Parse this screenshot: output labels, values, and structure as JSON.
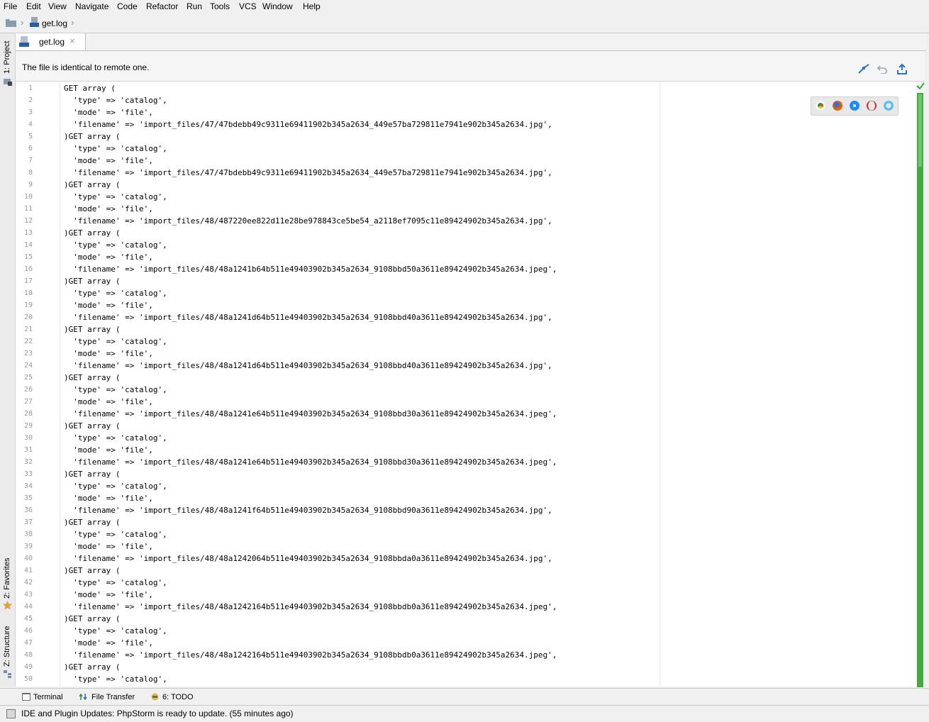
{
  "menu": [
    "File",
    "Edit",
    "View",
    "Navigate",
    "Code",
    "Refactor",
    "Run",
    "Tools",
    "VCS",
    "Window",
    "Help"
  ],
  "breadcrumb": {
    "file": "get.log"
  },
  "left_tools": {
    "project": "1: Project",
    "favorites": "2: Favorites",
    "structure": "Z: Structure"
  },
  "tab": {
    "label": "get.log",
    "close": "×",
    "icon_text": "LOG"
  },
  "notice": {
    "text": "The file is identical to remote one."
  },
  "editor": {
    "lines": [
      "GET array (",
      "  'type' => 'catalog',",
      "  'mode' => 'file',",
      "  'filename' => 'import_files/47/47bdebb49c9311e69411902b345a2634_449e57ba729811e7941e902b345a2634.jpg',",
      ")GET array (",
      "  'type' => 'catalog',",
      "  'mode' => 'file',",
      "  'filename' => 'import_files/47/47bdebb49c9311e69411902b345a2634_449e57ba729811e7941e902b345a2634.jpg',",
      ")GET array (",
      "  'type' => 'catalog',",
      "  'mode' => 'file',",
      "  'filename' => 'import_files/48/487220ee822d11e28be978843ce5be54_a2118ef7095c11e89424902b345a2634.jpg',",
      ")GET array (",
      "  'type' => 'catalog',",
      "  'mode' => 'file',",
      "  'filename' => 'import_files/48/48a1241b64b511e49403902b345a2634_9108bbd50a3611e89424902b345a2634.jpeg',",
      ")GET array (",
      "  'type' => 'catalog',",
      "  'mode' => 'file',",
      "  'filename' => 'import_files/48/48a1241d64b511e49403902b345a2634_9108bbd40a3611e89424902b345a2634.jpg',",
      ")GET array (",
      "  'type' => 'catalog',",
      "  'mode' => 'file',",
      "  'filename' => 'import_files/48/48a1241d64b511e49403902b345a2634_9108bbd40a3611e89424902b345a2634.jpg',",
      ")GET array (",
      "  'type' => 'catalog',",
      "  'mode' => 'file',",
      "  'filename' => 'import_files/48/48a1241e64b511e49403902b345a2634_9108bbd30a3611e89424902b345a2634.jpeg',",
      ")GET array (",
      "  'type' => 'catalog',",
      "  'mode' => 'file',",
      "  'filename' => 'import_files/48/48a1241e64b511e49403902b345a2634_9108bbd30a3611e89424902b345a2634.jpeg',",
      ")GET array (",
      "  'type' => 'catalog',",
      "  'mode' => 'file',",
      "  'filename' => 'import_files/48/48a1241f64b511e49403902b345a2634_9108bbd90a3611e89424902b345a2634.jpg',",
      ")GET array (",
      "  'type' => 'catalog',",
      "  'mode' => 'file',",
      "  'filename' => 'import_files/48/48a1242064b511e49403902b345a2634_9108bbda0a3611e89424902b345a2634.jpg',",
      ")GET array (",
      "  'type' => 'catalog',",
      "  'mode' => 'file',",
      "  'filename' => 'import_files/48/48a1242164b511e49403902b345a2634_9108bbdb0a3611e89424902b345a2634.jpeg',",
      ")GET array (",
      "  'type' => 'catalog',",
      "  'mode' => 'file',",
      "  'filename' => 'import_files/48/48a1242164b511e49403902b345a2634_9108bbdb0a3611e89424902b345a2634.jpeg',",
      ")GET array (",
      "  'type' => 'catalog',"
    ]
  },
  "bottom_tools": {
    "terminal": "Terminal",
    "file_transfer": "File Transfer",
    "todo": "6: TODO"
  },
  "status": {
    "text": "IDE and Plugin Updates: PhpStorm is ready to update. (55 minutes ago)"
  },
  "colors": {
    "accent": "#2f72c4",
    "inspection_ok": "#3cae3c",
    "line_numbers": "#999999"
  }
}
